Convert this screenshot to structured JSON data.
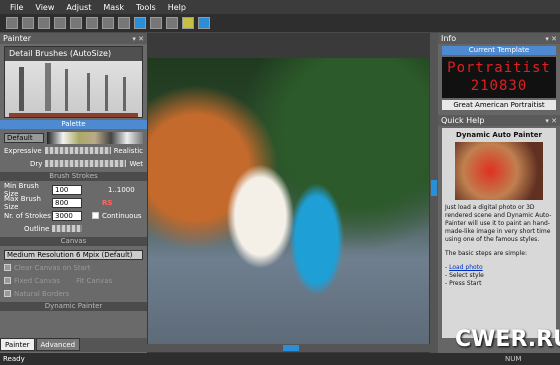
{
  "menu": [
    "File",
    "View",
    "Adjust",
    "Mask",
    "Tools",
    "Help"
  ],
  "painter": {
    "title": "Painter",
    "preset_name": "Detail Brushes (AutoSize)",
    "palette_label": "Palette",
    "palette_value": "Default",
    "expressive": "Expressive",
    "realistic": "Realistic",
    "dry": "Dry",
    "wet": "Wet",
    "brush_strokes_label": "Brush Strokes",
    "min_size_label": "Min Brush Size",
    "min_size": "100",
    "ratio": "1..1000",
    "max_size_label": "Max Brush Size",
    "max_size": "800",
    "rs_label": "RS",
    "strokes_label": "Nr. of Strokes",
    "strokes": "3000",
    "continuous": "Continuous",
    "outline": "Outline",
    "canvas_label": "Canvas",
    "resolution": "Medium Resolution 6 Mpix (Default)",
    "clear_canvas": "Clear Canvas on Start",
    "fixed_canvas": "Fixed Canvas",
    "fit_canvas": "Fit Canvas",
    "natural_borders": "Natural Borders",
    "dynamic_painter": "Dynamic Painter"
  },
  "tabs": {
    "painter": "Painter",
    "advanced": "Advanced"
  },
  "info": {
    "title": "Info",
    "current_template": "Current Template",
    "led_line1": "Portraitist",
    "led_line2": "210830",
    "template_name": "Great American Portraitist"
  },
  "quickhelp": {
    "title": "Quick Help",
    "heading": "Dynamic Auto Painter",
    "body": "Just load a digital photo or 3D rendered scene and Dynamic Auto-Painter will use it to paint an hand-made-like image in very short time using one of the famous styles.",
    "steps": "The basic steps are simple:",
    "step1": "Load photo",
    "step2": "- Select style",
    "step3": "- Press Start"
  },
  "status": {
    "ready": "Ready",
    "num": "NUM"
  },
  "watermark": "CWER.RU"
}
